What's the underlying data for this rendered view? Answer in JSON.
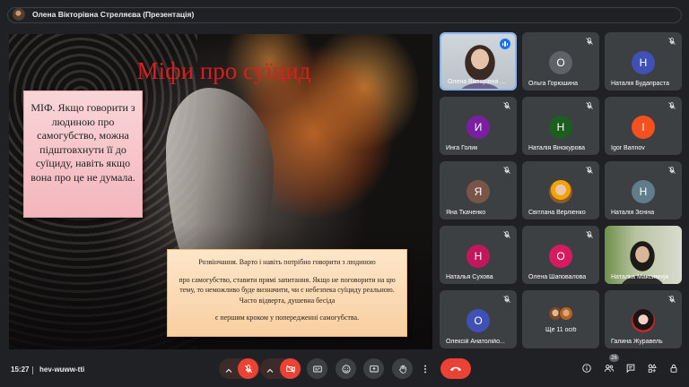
{
  "header": {
    "title": "Олена Вікторівна Стреляєва (Презентація)"
  },
  "slide": {
    "title": "Міфи про суїцид",
    "myth_text": "МІФ. Якщо говорити з людиною про самогубство, можна підштовхнути її до суїциду, навіть якщо вона про це не думала.",
    "debunk_p1": "Розвінчання. Варто і навіть потрібно говорити з людиною",
    "debunk_p2": "про самогубство, ставити прямі запитання. Якщо не поговорити на цю тему, то неможливо буде визначити, чи є небезпека суїциду реальною. Часто відверта, душевна бесіда",
    "debunk_p3": "є першим кроком у попередженні самогубства."
  },
  "participants": [
    {
      "name": "Олена Вікторівна ...",
      "type": "camera",
      "speaking": true
    },
    {
      "name": "Ольга Горюшина",
      "initial": "О",
      "color": "#5f6368"
    },
    {
      "name": "Наталія Будапраста",
      "initial": "Н",
      "color": "#3f51b5"
    },
    {
      "name": "Инга Голик",
      "initial": "И",
      "color": "#7b1fa2"
    },
    {
      "name": "Наталія Вінокурова",
      "initial": "Н",
      "color": "#1b5e20"
    },
    {
      "name": "Igor Barinov",
      "initial": "I",
      "color": "#f4511e"
    },
    {
      "name": "Яна Ткаченко",
      "initial": "Я",
      "color": "#795548"
    },
    {
      "name": "Світлана Верліенко",
      "type": "photo"
    },
    {
      "name": "Наталія Зєніна",
      "initial": "Н",
      "color": "#607d8b"
    },
    {
      "name": "Наталья Сухова",
      "initial": "Н",
      "color": "#c2185b"
    },
    {
      "name": "Олена Шаповалова",
      "initial": "О",
      "color": "#d81b60"
    },
    {
      "name": "Наталка Максимчук",
      "type": "camera2"
    },
    {
      "name": "Олексій Анатолійо...",
      "initial": "О",
      "color": "#3f51b5"
    },
    {
      "name": "Ще 11 осіб",
      "type": "more"
    },
    {
      "name": "Галина Журавель",
      "type": "photo2"
    }
  ],
  "bottombar": {
    "time": "15:27",
    "meeting_code": "hev-wuww-tti",
    "participant_count": "26"
  },
  "icons": {
    "mic_off": "mic-off-icon",
    "cam_off": "camera-off-icon",
    "captions": "captions-icon",
    "emoji": "emoji-icon",
    "present": "present-icon",
    "hand": "raise-hand-icon",
    "more": "more-vert-icon",
    "end": "end-call-icon",
    "info": "info-icon",
    "people": "people-icon",
    "chat": "chat-icon",
    "activities": "activities-icon",
    "lock": "lock-icon"
  }
}
